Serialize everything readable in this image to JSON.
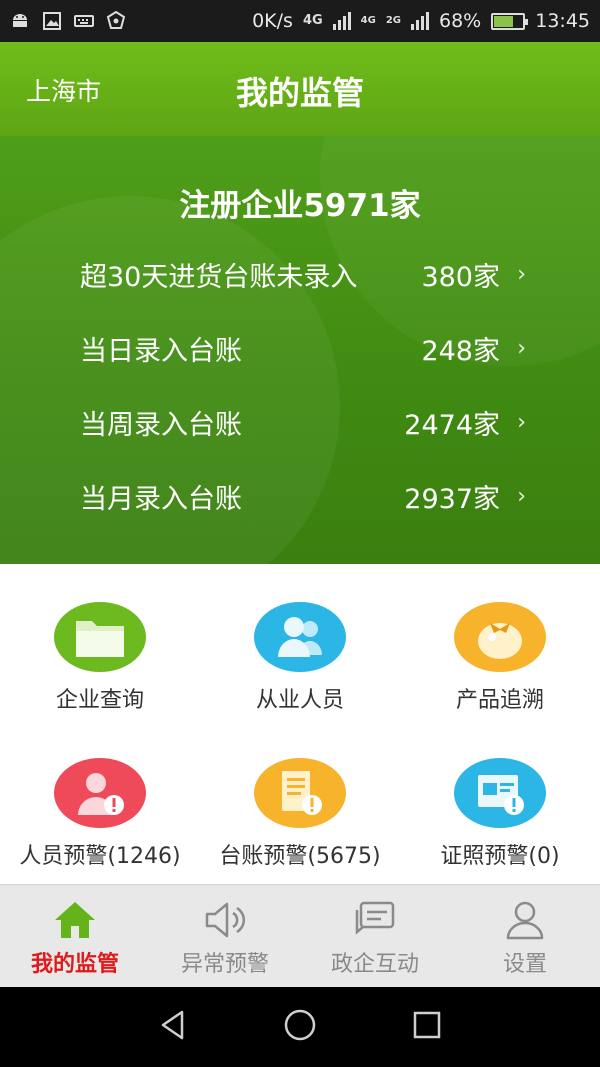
{
  "status_bar": {
    "net_speed": "0K/s",
    "net_4g_a": "4G",
    "net_4g_b": "4G",
    "net_2g": "2G",
    "battery": "68%",
    "battery_level": 0.68,
    "time": "13:45"
  },
  "header": {
    "city": "上海市",
    "title": "我的监管"
  },
  "summary": {
    "title": "注册企业5971家",
    "rows": [
      {
        "label": "超30天进货台账未录入",
        "value": "380家"
      },
      {
        "label": "当日录入台账",
        "value": "248家"
      },
      {
        "label": "当周录入台账",
        "value": "2474家"
      },
      {
        "label": "当月录入台账",
        "value": "2937家"
      }
    ]
  },
  "grid": {
    "tiles": [
      {
        "label": "企业查询",
        "icon": "folder-icon",
        "color": "#6cba1f"
      },
      {
        "label": "从业人员",
        "icon": "people-icon",
        "color": "#2bb6e6"
      },
      {
        "label": "产品追溯",
        "icon": "tomato-icon",
        "color": "#f7b32b"
      },
      {
        "label": "人员预警(1246)",
        "icon": "person-alert-icon",
        "color": "#ef4a5a"
      },
      {
        "label": "台账预警(5675)",
        "icon": "ledger-alert-icon",
        "color": "#f7b32b"
      },
      {
        "label": "证照预警(0)",
        "icon": "license-alert-icon",
        "color": "#2bb6e6"
      }
    ]
  },
  "bottom_nav": {
    "items": [
      {
        "label": "我的监管",
        "icon": "home-icon",
        "active": true
      },
      {
        "label": "异常预警",
        "icon": "speaker-icon",
        "active": false
      },
      {
        "label": "政企互动",
        "icon": "chat-icon",
        "active": false
      },
      {
        "label": "设置",
        "icon": "user-icon",
        "active": false
      }
    ]
  },
  "colors": {
    "header": "#65b016",
    "summary": "#458f14",
    "active_nav": "#e01a1a",
    "inactive_nav": "#8a8a8a"
  }
}
